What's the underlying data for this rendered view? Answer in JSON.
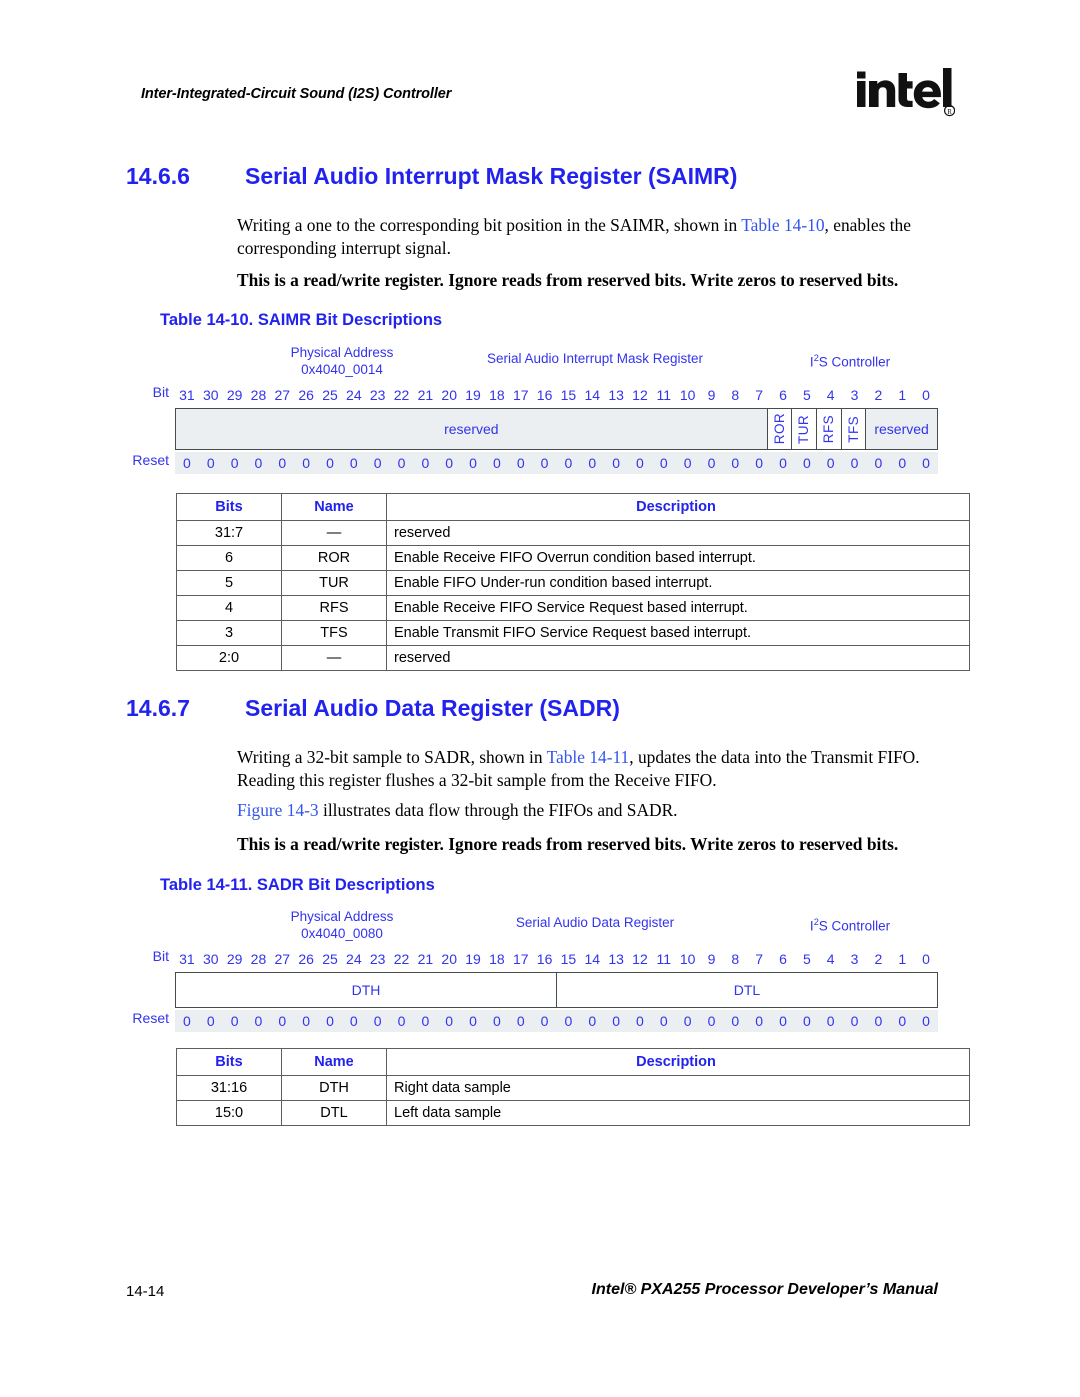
{
  "header": {
    "running_head": "Inter-Integrated-Circuit Sound (I2S) Controller",
    "logo_name": "intel-logo"
  },
  "sections": [
    {
      "number": "14.6.6",
      "title": "Serial Audio Interrupt Mask Register (SAIMR)",
      "paragraphs": [
        {
          "style": "normal",
          "parts": [
            {
              "text": "Writing a one to the corresponding bit position in the SAIMR, shown in ",
              "link": false
            },
            {
              "text": "Table 14-10",
              "link": true
            },
            {
              "text": ", enables the corresponding interrupt signal.",
              "link": false
            }
          ]
        },
        {
          "style": "bold",
          "parts": [
            {
              "text": "This is a read/write register. Ignore reads from reserved bits. Write zeros to reserved bits.",
              "link": false
            }
          ]
        }
      ],
      "table_caption": "Table 14-10. SAIMR Bit Descriptions",
      "register": {
        "physical_address_label": "Physical Address",
        "physical_address_value": "0x4040_0014",
        "register_name": "Serial Audio Interrupt Mask Register",
        "controller": "I2S Controller",
        "controller_sup": "2",
        "bit_label": "Bit",
        "reset_label": "Reset",
        "bit_numbers": [
          "31",
          "30",
          "29",
          "28",
          "27",
          "26",
          "25",
          "24",
          "23",
          "22",
          "21",
          "20",
          "19",
          "18",
          "17",
          "16",
          "15",
          "14",
          "13",
          "12",
          "11",
          "10",
          "9",
          "8",
          "7",
          "6",
          "5",
          "4",
          "3",
          "2",
          "1",
          "0"
        ],
        "fields": [
          {
            "label": "reserved",
            "span": 25,
            "orient": "horizontal",
            "fill": "gray"
          },
          {
            "label": "ROR",
            "span": 1,
            "orient": "vertical",
            "fill": "white"
          },
          {
            "label": "TUR",
            "span": 1,
            "orient": "vertical",
            "fill": "white"
          },
          {
            "label": "RFS",
            "span": 1,
            "orient": "vertical",
            "fill": "white"
          },
          {
            "label": "TFS",
            "span": 1,
            "orient": "vertical",
            "fill": "white"
          },
          {
            "label": "reserved",
            "span": 3,
            "orient": "horizontal",
            "fill": "gray"
          }
        ],
        "reset_values": [
          "0",
          "0",
          "0",
          "0",
          "0",
          "0",
          "0",
          "0",
          "0",
          "0",
          "0",
          "0",
          "0",
          "0",
          "0",
          "0",
          "0",
          "0",
          "0",
          "0",
          "0",
          "0",
          "0",
          "0",
          "0",
          "0",
          "0",
          "0",
          "0",
          "0",
          "0",
          "0"
        ]
      },
      "bit_table": {
        "headers": [
          "Bits",
          "Name",
          "Description"
        ],
        "rows": [
          [
            "31:7",
            "—",
            "reserved"
          ],
          [
            "6",
            "ROR",
            "Enable Receive FIFO Overrun condition based interrupt."
          ],
          [
            "5",
            "TUR",
            "Enable FIFO Under-run condition based interrupt."
          ],
          [
            "4",
            "RFS",
            "Enable Receive FIFO Service Request based interrupt."
          ],
          [
            "3",
            "TFS",
            "Enable Transmit FIFO Service Request based interrupt."
          ],
          [
            "2:0",
            "—",
            "reserved"
          ]
        ]
      }
    },
    {
      "number": "14.6.7",
      "title": "Serial Audio Data Register (SADR)",
      "paragraphs": [
        {
          "style": "normal",
          "parts": [
            {
              "text": "Writing a 32-bit sample to SADR, shown in ",
              "link": false
            },
            {
              "text": "Table 14-11",
              "link": true
            },
            {
              "text": ", updates the data into the Transmit FIFO. Reading this register flushes a 32-bit sample from the Receive FIFO.",
              "link": false
            }
          ]
        },
        {
          "style": "normal",
          "parts": [
            {
              "text": "Figure 14-3",
              "link": true
            },
            {
              "text": " illustrates data flow through the FIFOs and SADR.",
              "link": false
            }
          ]
        },
        {
          "style": "bold",
          "parts": [
            {
              "text": "This is a read/write register. Ignore reads from reserved bits. Write zeros to reserved bits.",
              "link": false
            }
          ]
        }
      ],
      "table_caption": "Table 14-11. SADR Bit Descriptions",
      "register": {
        "physical_address_label": "Physical Address",
        "physical_address_value": "0x4040_0080",
        "register_name": "Serial Audio Data Register",
        "controller": "I2S Controller",
        "controller_sup": "2",
        "bit_label": "Bit",
        "reset_label": "Reset",
        "bit_numbers": [
          "31",
          "30",
          "29",
          "28",
          "27",
          "26",
          "25",
          "24",
          "23",
          "22",
          "21",
          "20",
          "19",
          "18",
          "17",
          "16",
          "15",
          "14",
          "13",
          "12",
          "11",
          "10",
          "9",
          "8",
          "7",
          "6",
          "5",
          "4",
          "3",
          "2",
          "1",
          "0"
        ],
        "fields": [
          {
            "label": "DTH",
            "span": 16,
            "orient": "horizontal",
            "fill": "white"
          },
          {
            "label": "DTL",
            "span": 16,
            "orient": "horizontal",
            "fill": "white"
          }
        ],
        "reset_values": [
          "0",
          "0",
          "0",
          "0",
          "0",
          "0",
          "0",
          "0",
          "0",
          "0",
          "0",
          "0",
          "0",
          "0",
          "0",
          "0",
          "0",
          "0",
          "0",
          "0",
          "0",
          "0",
          "0",
          "0",
          "0",
          "0",
          "0",
          "0",
          "0",
          "0",
          "0",
          "0"
        ]
      },
      "bit_table": {
        "headers": [
          "Bits",
          "Name",
          "Description"
        ],
        "rows": [
          [
            "31:16",
            "DTH",
            "Right data sample"
          ],
          [
            "15:0",
            "DTL",
            "Left data sample"
          ]
        ]
      }
    }
  ],
  "footer": {
    "page_number": "14-14",
    "manual_title": "Intel® PXA255 Processor Developer’s Manual"
  },
  "colors": {
    "heading_blue": "#2222EE",
    "diagram_blue": "#3333EE",
    "diagram_fill": "#EBEFF2",
    "border": "#444c4c"
  }
}
